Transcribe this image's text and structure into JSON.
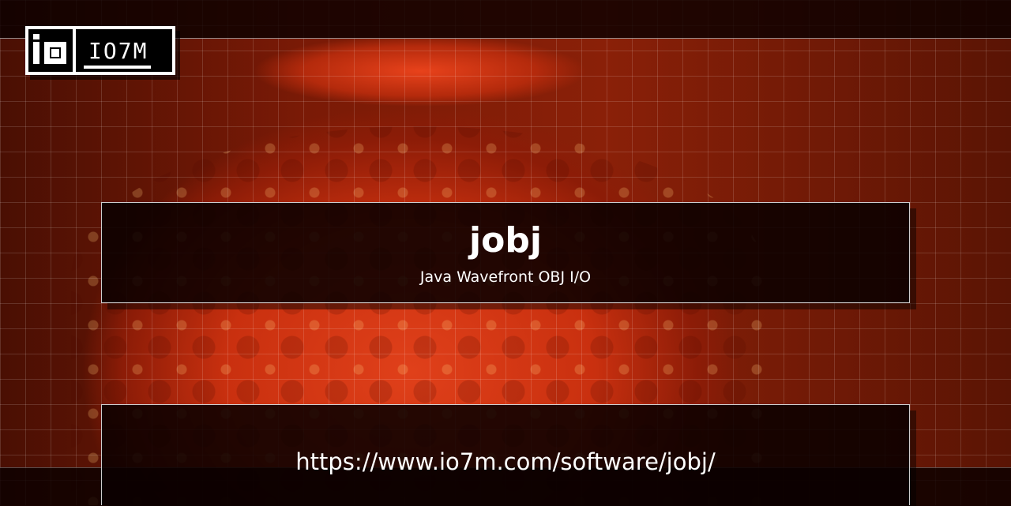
{
  "brand": {
    "logo_text": "IO7M"
  },
  "project": {
    "name": "jobj",
    "description": "Java Wavefront OBJ I/O",
    "url": "https://www.io7m.com/software/jobj/"
  },
  "colors": {
    "background": "#8a2008",
    "panel": "#0a0000",
    "text": "#ffffff",
    "accent": "#e0401a"
  }
}
